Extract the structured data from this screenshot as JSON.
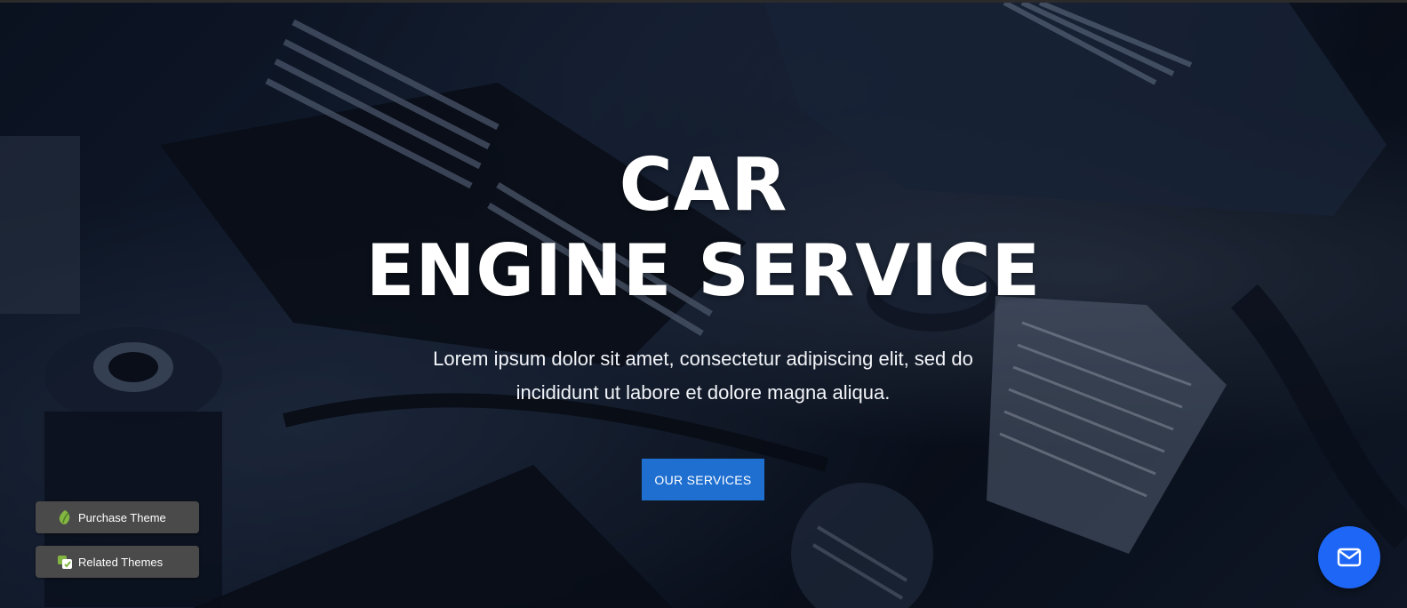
{
  "hero": {
    "title_line1": "CAR",
    "title_line2": "ENGINE SERVICE",
    "subtitle": "Lorem ipsum dolor sit amet, consectetur adipiscing elit, sed do incididunt ut labore et dolore magna aliqua.",
    "cta_label": "OUR SERVICES"
  },
  "side_buttons": {
    "purchase_label": "Purchase Theme",
    "related_label": "Related Themes"
  },
  "icons": {
    "purchase": "envato-leaf-icon",
    "related": "related-themes-icon",
    "contact": "envelope-icon"
  },
  "colors": {
    "cta": "#1f6fd1",
    "fab": "#1e66f5",
    "side_button": "#4a4a4a"
  }
}
